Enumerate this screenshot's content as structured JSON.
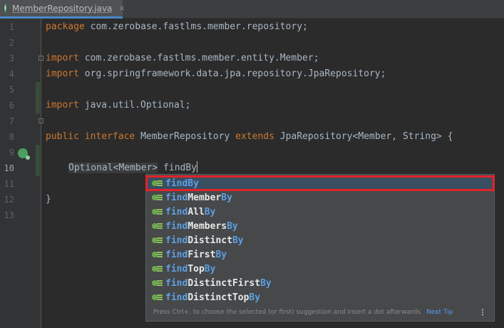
{
  "tab": {
    "icon_letter": "I",
    "label": "MemberRepository.java",
    "close": "×"
  },
  "gutter": {
    "line_numbers": [
      "1",
      "2",
      "3",
      "4",
      "5",
      "6",
      "7",
      "8",
      "9",
      "10",
      "11",
      "12",
      "13"
    ],
    "current_line": "10"
  },
  "code": {
    "line1_kw": "package",
    "line1_rest": " com.zerobase.fastlms.member.repository;",
    "line3_kw": "import",
    "line3_rest": " com.zerobase.fastlms.member.entity.Member;",
    "line4_kw": "import",
    "line4_rest": " org.springframework.data.jpa.repository.JpaRepository;",
    "line6_kw": "import",
    "line6_rest": " java.util.Optional;",
    "line8_kw1": "public",
    "line8_kw2": "interface",
    "line8_name": " MemberRepository ",
    "line8_kw3": "extends",
    "line8_rest": " JpaRepository<Member, String> {",
    "line10_type": "Optional<Member>",
    "line10_text": " findBy",
    "line12": "}"
  },
  "completion": {
    "items": [
      {
        "match": "findBy",
        "rest": ""
      },
      {
        "match": "find",
        "mid": "Member",
        "end": "By"
      },
      {
        "match": "find",
        "mid": "All",
        "end": "By"
      },
      {
        "match": "find",
        "mid": "Members",
        "end": "By"
      },
      {
        "match": "find",
        "mid": "Distinct",
        "end": "By"
      },
      {
        "match": "find",
        "mid": "First",
        "end": "By"
      },
      {
        "match": "find",
        "mid": "Top",
        "end": "By"
      },
      {
        "match": "find",
        "mid": "DistinctFirst",
        "end": "By"
      },
      {
        "match": "find",
        "mid": "DistinctTop",
        "end": "By"
      }
    ],
    "selected_index": 0,
    "footer_hint": "Press Ctrl+. to choose the selected (or first) suggestion and insert a dot afterwards",
    "footer_link": "Next Tip",
    "menu_icon": "kebab-menu-icon"
  },
  "colors": {
    "keyword": "#cc7832",
    "text": "#a9b7c6",
    "match": "#5d9fe3",
    "selection_outline": "#e0242a"
  }
}
